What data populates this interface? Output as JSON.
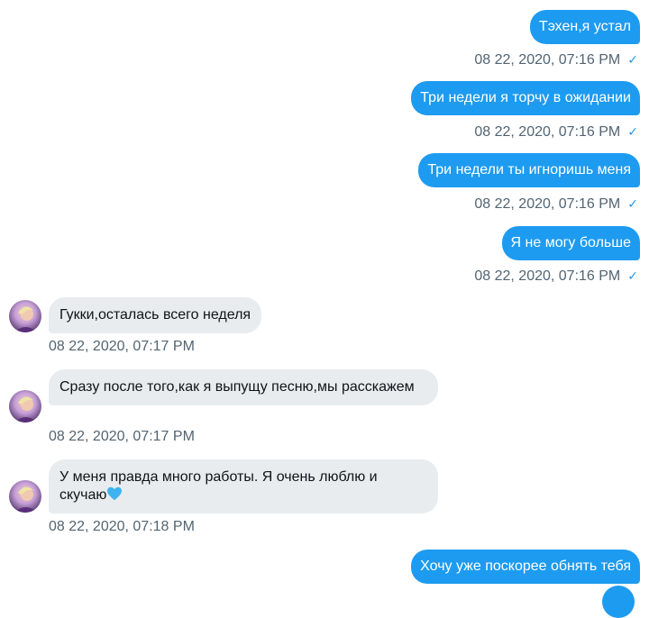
{
  "messages": [
    {
      "text": "Тэхен,я устал",
      "time": "08 22, 2020, 07:16 PM"
    },
    {
      "text": "Три недели я торчу в ожидании",
      "time": "08 22, 2020, 07:16 PM"
    },
    {
      "text": "Три недели ты игноришь меня",
      "time": "08 22, 2020, 07:16 PM"
    },
    {
      "text": "Я не могу больше",
      "time": "08 22, 2020, 07:16 PM"
    },
    {
      "text": "Гукки,осталась всего неделя",
      "time": "08 22, 2020, 07:17 PM"
    },
    {
      "text": "Сразу после того,как я выпущу песню,мы расскажем",
      "time": "08 22, 2020, 07:17 PM"
    },
    {
      "text": "У меня правда много работы. Я очень люблю и скучаю",
      "time": "08 22, 2020, 07:18 PM"
    },
    {
      "text": "Хочу уже поскорее обнять тебя",
      "time": ""
    }
  ],
  "icons": {
    "read_receipt": "checkmark-icon",
    "heart": "blue-heart-icon",
    "avatar": "contact-avatar"
  },
  "colors": {
    "outgoing_bubble": "#1d9bf0",
    "incoming_bubble": "#e8ecef",
    "timestamp": "#536471",
    "check": "#1d9bf0"
  }
}
